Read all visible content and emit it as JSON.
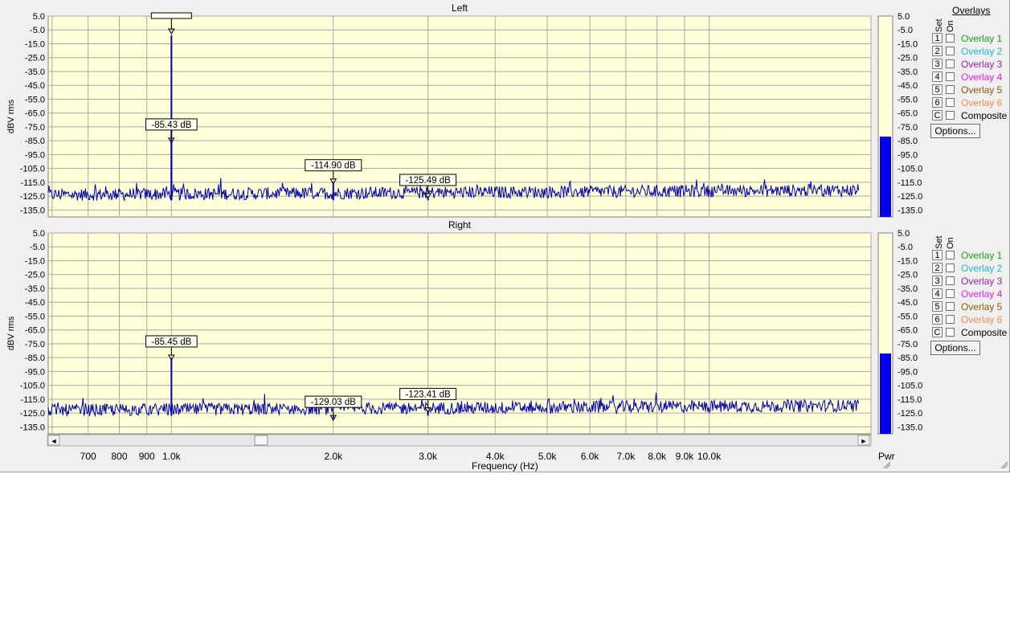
{
  "overlays_header": "Overlays",
  "column_set": "Set",
  "column_on": "On",
  "overlay_items": [
    {
      "key": "1",
      "name": "Overlay 1",
      "color": "#1a9e1a"
    },
    {
      "key": "2",
      "name": "Overlay 2",
      "color": "#21b5c9"
    },
    {
      "key": "3",
      "name": "Overlay 3",
      "color": "#9b1fa8"
    },
    {
      "key": "4",
      "name": "Overlay 4",
      "color": "#e020e0"
    },
    {
      "key": "5",
      "name": "Overlay 5",
      "color": "#8a5a00"
    },
    {
      "key": "6",
      "name": "Overlay 6",
      "color": "#f08a50"
    },
    {
      "key": "C",
      "name": "Composite",
      "color": "#000000"
    }
  ],
  "options_label": "Options...",
  "meter_label": "Pwr",
  "meter_color": "#0000ee",
  "trace_color": "#0000aa",
  "plot_bg": "#ffffd8",
  "chart_data": [
    {
      "type": "line",
      "title": "Left",
      "ylabel": "dBV rms",
      "xlabel": "Frequency (Hz)",
      "x_scale": "log",
      "xlim": [
        590,
        20000
      ],
      "ylim": [
        -140,
        5
      ],
      "yticks": [
        "5.0",
        "-5.0",
        "-15.0",
        "-25.0",
        "-35.0",
        "-45.0",
        "-55.0",
        "-65.0",
        "-75.0",
        "-85.0",
        "-95.0",
        "-105.0",
        "-115.0",
        "-125.0",
        "-135.0"
      ],
      "noise_floor": -124,
      "peaks": [
        {
          "x": 1000,
          "y": -9
        },
        {
          "x": 1000,
          "y": -85.43
        },
        {
          "x": 2000,
          "y": -114.9
        },
        {
          "x": 3000,
          "y": -125.49
        }
      ],
      "markers": [
        {
          "x": 1000,
          "y": -85.43,
          "label": "-85.43 dB"
        },
        {
          "x": 2000,
          "y": -114.9,
          "label": "-114.90 dB"
        },
        {
          "x": 3000,
          "y": -125.49,
          "label": "-125.49 dB"
        }
      ],
      "meter_ticks": [
        "5.0",
        "-5.0",
        "-15.0",
        "-25.0",
        "-35.0",
        "-45.0",
        "-55.0",
        "-65.0",
        "-75.0",
        "-85.0",
        "-95.0",
        "-105.0",
        "-115.0",
        "-125.0",
        "-135.0"
      ],
      "meter_level_db": -82
    },
    {
      "type": "line",
      "title": "Right",
      "ylabel": "dBV rms",
      "xlabel": "Frequency (Hz)",
      "x_scale": "log",
      "xlim": [
        590,
        20000
      ],
      "ylim": [
        -140,
        5
      ],
      "yticks": [
        "5.0",
        "-5.0",
        "-15.0",
        "-25.0",
        "-35.0",
        "-45.0",
        "-55.0",
        "-65.0",
        "-75.0",
        "-85.0",
        "-95.0",
        "-105.0",
        "-115.0",
        "-125.0",
        "-135.0"
      ],
      "noise_floor": -123,
      "peaks": [
        {
          "x": 1000,
          "y": -85.45
        },
        {
          "x": 2000,
          "y": -129.03
        },
        {
          "x": 3000,
          "y": -123.41
        }
      ],
      "markers": [
        {
          "x": 1000,
          "y": -85.45,
          "label": "-85.45 dB"
        },
        {
          "x": 2000,
          "y": -129.03,
          "label": "-129.03 dB"
        },
        {
          "x": 3000,
          "y": -123.41,
          "label": "-123.41 dB"
        }
      ],
      "meter_ticks": [
        "5.0",
        "-5.0",
        "-15.0",
        "-25.0",
        "-35.0",
        "-45.0",
        "-55.0",
        "-65.0",
        "-75.0",
        "-85.0",
        "-95.0",
        "-105.0",
        "-115.0",
        "-125.0",
        "-135.0"
      ],
      "meter_level_db": -82
    }
  ],
  "x_ticks": [
    {
      "x": 700,
      "label": "700"
    },
    {
      "x": 800,
      "label": "800"
    },
    {
      "x": 900,
      "label": "900"
    },
    {
      "x": 1000,
      "label": "1.0k"
    },
    {
      "x": 2000,
      "label": "2.0k"
    },
    {
      "x": 3000,
      "label": "3.0k"
    },
    {
      "x": 4000,
      "label": "4.0k"
    },
    {
      "x": 5000,
      "label": "5.0k"
    },
    {
      "x": 6000,
      "label": "6.0k"
    },
    {
      "x": 7000,
      "label": "7.0k"
    },
    {
      "x": 8000,
      "label": "8.0k"
    },
    {
      "x": 9000,
      "label": "9.0k"
    },
    {
      "x": 10000,
      "label": "10.0k"
    }
  ],
  "x_axis_label": "Frequency (Hz)",
  "scroll_left_glyph": "◄",
  "scroll_right_glyph": "►"
}
